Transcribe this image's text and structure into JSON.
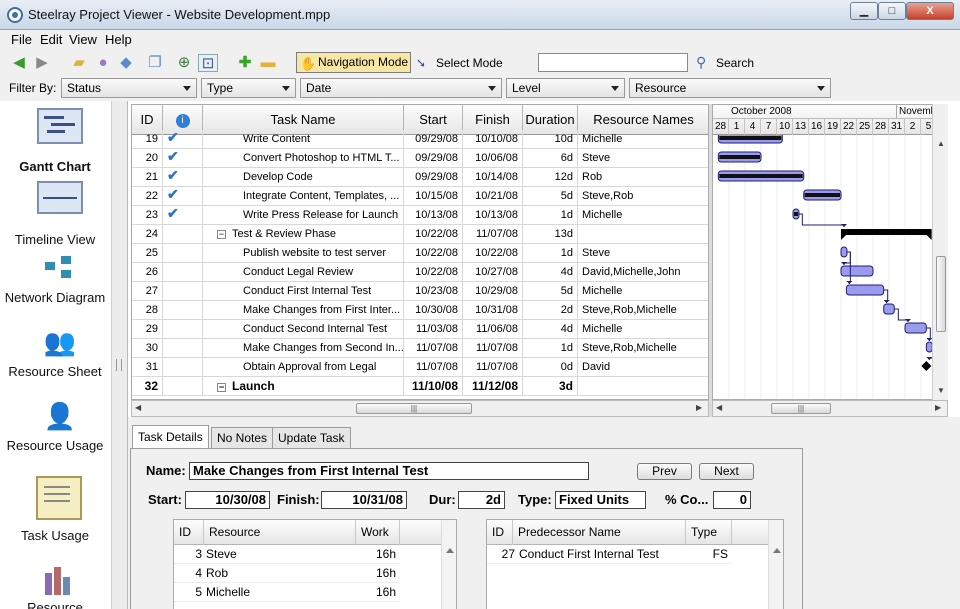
{
  "window": {
    "title": "Steelray Project Viewer - Website Development.mpp",
    "min": "▁",
    "max": "□",
    "close": "X"
  },
  "menu": [
    "File",
    "Edit",
    "View",
    "Help"
  ],
  "toolbar": {
    "navigation_mode": "Navigation Mode",
    "select_mode": "Select Mode",
    "search_value": "",
    "search_label": "Search"
  },
  "filter": {
    "label": "Filter By:",
    "combos": [
      "Status",
      "Type",
      "Date",
      "Level",
      "Resource"
    ]
  },
  "views": [
    {
      "label": "Gantt Chart",
      "active": true
    },
    {
      "label": "Timeline View"
    },
    {
      "label": "Network Diagram"
    },
    {
      "label": "Resource Sheet"
    },
    {
      "label": "Resource Usage"
    },
    {
      "label": "Task Usage"
    },
    {
      "label": "Resource"
    }
  ],
  "grid": {
    "columns": [
      "ID",
      "",
      "Task Name",
      "Start",
      "Finish",
      "Duration",
      "Resource Names"
    ],
    "rows": [
      {
        "id": "19",
        "check": true,
        "name": "Write Content",
        "start": "09/29/08",
        "finish": "10/10/08",
        "duration": "10d",
        "resources": "Michelle",
        "indent": 2
      },
      {
        "id": "20",
        "check": true,
        "name": "Convert Photoshop to HTML T...",
        "start": "09/29/08",
        "finish": "10/06/08",
        "duration": "6d",
        "resources": "Steve",
        "indent": 2
      },
      {
        "id": "21",
        "check": true,
        "name": "Develop Code",
        "start": "09/29/08",
        "finish": "10/14/08",
        "duration": "12d",
        "resources": "Rob",
        "indent": 2
      },
      {
        "id": "22",
        "check": true,
        "name": "Integrate Content, Templates, ...",
        "start": "10/15/08",
        "finish": "10/21/08",
        "duration": "5d",
        "resources": "Steve,Rob",
        "indent": 2
      },
      {
        "id": "23",
        "check": true,
        "name": "Write Press Release for Launch",
        "start": "10/13/08",
        "finish": "10/13/08",
        "duration": "1d",
        "resources": "Michelle",
        "indent": 2
      },
      {
        "id": "24",
        "check": false,
        "name": "Test & Review Phase",
        "start": "10/22/08",
        "finish": "11/07/08",
        "duration": "13d",
        "resources": "",
        "indent": 1,
        "summary": true
      },
      {
        "id": "25",
        "check": false,
        "name": "Publish website to test server",
        "start": "10/22/08",
        "finish": "10/22/08",
        "duration": "1d",
        "resources": "Steve",
        "indent": 2
      },
      {
        "id": "26",
        "check": false,
        "name": "Conduct Legal Review",
        "start": "10/22/08",
        "finish": "10/27/08",
        "duration": "4d",
        "resources": "David,Michelle,John",
        "indent": 2
      },
      {
        "id": "27",
        "check": false,
        "name": "Conduct First Internal Test",
        "start": "10/23/08",
        "finish": "10/29/08",
        "duration": "5d",
        "resources": "Michelle",
        "indent": 2
      },
      {
        "id": "28",
        "check": false,
        "name": "Make Changes from First Inter...",
        "start": "10/30/08",
        "finish": "10/31/08",
        "duration": "2d",
        "resources": "Steve,Rob,Michelle",
        "indent": 2
      },
      {
        "id": "29",
        "check": false,
        "name": "Conduct Second Internal Test",
        "start": "11/03/08",
        "finish": "11/06/08",
        "duration": "4d",
        "resources": "Michelle",
        "indent": 2
      },
      {
        "id": "30",
        "check": false,
        "name": "Make Changes from Second In...",
        "start": "11/07/08",
        "finish": "11/07/08",
        "duration": "1d",
        "resources": "Steve,Rob,Michelle",
        "indent": 2
      },
      {
        "id": "31",
        "check": false,
        "name": "Obtain Approval from Legal",
        "start": "11/07/08",
        "finish": "11/07/08",
        "duration": "0d",
        "resources": "David",
        "indent": 2
      },
      {
        "id": "32",
        "check": false,
        "name": "Launch",
        "start": "11/10/08",
        "finish": "11/12/08",
        "duration": "3d",
        "resources": "",
        "indent": 1,
        "summary": true,
        "bold": true
      }
    ]
  },
  "gantt": {
    "months": [
      "October 2008",
      "Novemb"
    ],
    "days": [
      "28",
      "1",
      "4",
      "7",
      "10",
      "13",
      "16",
      "19",
      "22",
      "25",
      "28",
      "31",
      "2",
      "5"
    ]
  },
  "tabs": [
    "Task Details",
    "No Notes",
    "Update Task"
  ],
  "detail": {
    "name_label": "Name:",
    "name_value": "Make Changes from First Internal Test",
    "prev": "Prev",
    "next": "Next",
    "start_label": "Start:",
    "start_value": "10/30/08",
    "finish_label": "Finish:",
    "finish_value": "10/31/08",
    "dur_label": "Dur:",
    "dur_value": "2d",
    "type_label": "Type:",
    "type_value": "Fixed Units",
    "complete_label": "% Co...",
    "complete_value": "0",
    "resources": {
      "columns": [
        "ID",
        "Resource",
        "Work"
      ],
      "rows": [
        {
          "id": "3",
          "name": "Steve",
          "work": "16h"
        },
        {
          "id": "4",
          "name": "Rob",
          "work": "16h"
        },
        {
          "id": "5",
          "name": "Michelle",
          "work": "16h"
        }
      ]
    },
    "predecessors": {
      "columns": [
        "ID",
        "Predecessor Name",
        "Type"
      ],
      "rows": [
        {
          "id": "27",
          "name": "Conduct First Internal Test",
          "type": "FS"
        }
      ]
    }
  }
}
